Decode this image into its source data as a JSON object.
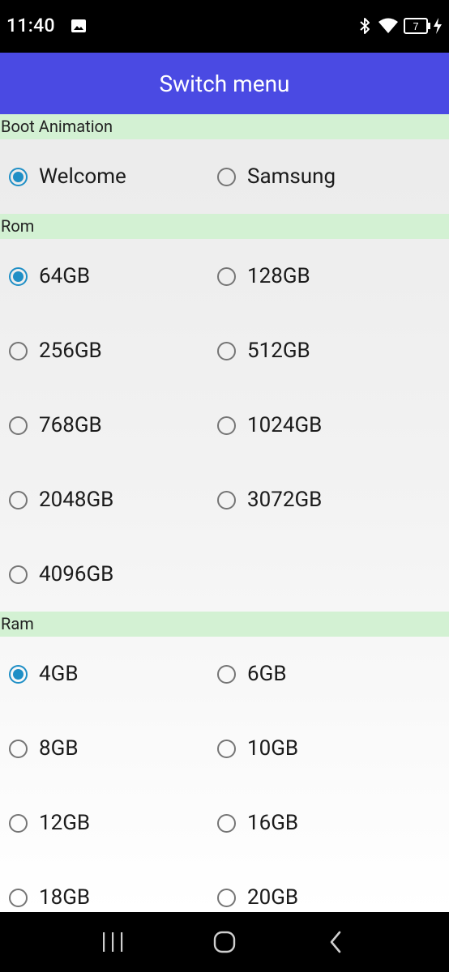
{
  "status_bar": {
    "time": "11:40",
    "battery_level": "7",
    "icons": [
      "image-icon",
      "bluetooth-icon",
      "wifi-icon",
      "battery-icon",
      "charging-icon"
    ]
  },
  "app_bar": {
    "title": "Switch menu"
  },
  "sections": [
    {
      "title": "Boot Animation",
      "options": [
        {
          "label": "Welcome",
          "checked": true
        },
        {
          "label": "Samsung",
          "checked": false
        }
      ]
    },
    {
      "title": "Rom",
      "options": [
        {
          "label": "64GB",
          "checked": true
        },
        {
          "label": "128GB",
          "checked": false
        },
        {
          "label": "256GB",
          "checked": false
        },
        {
          "label": "512GB",
          "checked": false
        },
        {
          "label": "768GB",
          "checked": false
        },
        {
          "label": "1024GB",
          "checked": false
        },
        {
          "label": "2048GB",
          "checked": false
        },
        {
          "label": "3072GB",
          "checked": false
        },
        {
          "label": "4096GB",
          "checked": false
        }
      ]
    },
    {
      "title": "Ram",
      "options": [
        {
          "label": "4GB",
          "checked": true
        },
        {
          "label": "6GB",
          "checked": false
        },
        {
          "label": "8GB",
          "checked": false
        },
        {
          "label": "10GB",
          "checked": false
        },
        {
          "label": "12GB",
          "checked": false
        },
        {
          "label": "16GB",
          "checked": false
        },
        {
          "label": "18GB",
          "checked": false
        },
        {
          "label": "20GB",
          "checked": false
        }
      ]
    }
  ],
  "nav_bar": {
    "buttons": [
      "recents-icon",
      "home-icon",
      "back-icon"
    ]
  },
  "colors": {
    "accent": "#1f8fc6",
    "app_bar": "#4a4ae3",
    "section_header": "#d3f1d3"
  }
}
